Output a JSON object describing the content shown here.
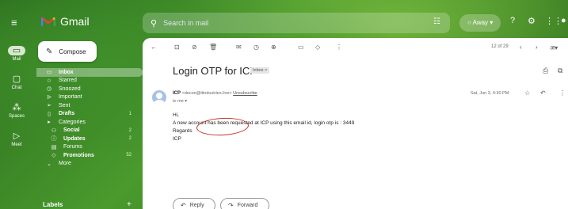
{
  "app": {
    "name": "Gmail"
  },
  "rail": {
    "items": [
      {
        "label": "Mail",
        "icon": "mail-icon"
      },
      {
        "label": "Chat",
        "icon": "chat-icon"
      },
      {
        "label": "Spaces",
        "icon": "spaces-icon"
      },
      {
        "label": "Meet",
        "icon": "meet-icon"
      }
    ]
  },
  "search": {
    "placeholder": "Search in mail"
  },
  "status": {
    "label": "Away"
  },
  "compose": {
    "label": "Compose"
  },
  "sidebar": {
    "items": [
      {
        "label": "Inbox",
        "icon": "inbox-icon",
        "count": "",
        "active": true,
        "bold": true
      },
      {
        "label": "Starred",
        "icon": "star-icon",
        "count": ""
      },
      {
        "label": "Snoozed",
        "icon": "clock-icon",
        "count": ""
      },
      {
        "label": "Important",
        "icon": "important-icon",
        "count": ""
      },
      {
        "label": "Sent",
        "icon": "send-icon",
        "count": ""
      },
      {
        "label": "Drafts",
        "icon": "draft-icon",
        "count": "1",
        "bold": true
      },
      {
        "label": "Categories",
        "icon": "label-icon",
        "count": ""
      },
      {
        "label": "Social",
        "icon": "people-icon",
        "count": "2",
        "bold": true,
        "indent": true
      },
      {
        "label": "Updates",
        "icon": "info-icon",
        "count": "2",
        "bold": true,
        "indent": true
      },
      {
        "label": "Forums",
        "icon": "forum-icon",
        "count": "",
        "indent": true
      },
      {
        "label": "Promotions",
        "icon": "tag-icon",
        "count": "52",
        "bold": true,
        "indent": true
      },
      {
        "label": "More",
        "icon": "chevron-down-icon",
        "count": ""
      }
    ],
    "labels_heading": "Labels"
  },
  "toolbar": {
    "pager": "12 of 29"
  },
  "email": {
    "subject": "Login OTP for ICP",
    "tag": "Inbox ×",
    "sender_name": "ICP",
    "sender_email": "<decon@itindustries.live>",
    "unsubscribe": "Unsubscribe",
    "to": "to me ▾",
    "date": "Sat, Jun 3, 4:30 PM",
    "greeting": "Hi,",
    "line1": "A new account has been requested at ICP using this email id, login otp is : 3449",
    "regards": "Regards",
    "signature": "ICP"
  },
  "actions": {
    "reply": "Reply",
    "forward": "Forward"
  },
  "colors": {
    "theme_green": "#2b6e1f",
    "annotation_red": "#c4342b"
  }
}
